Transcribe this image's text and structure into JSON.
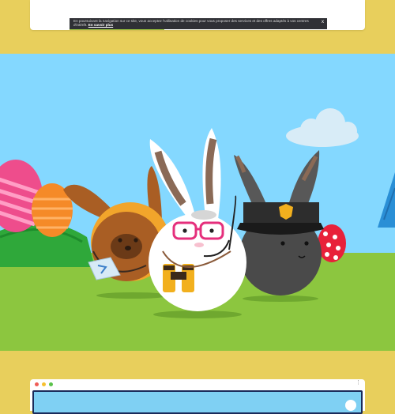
{
  "cookie_banner": {
    "text": "En poursuivant la navigation sur ce site, vous acceptez l'utilisation de cookies pour vous proposer des services et des offres adaptés à vos centres d'intérêt.",
    "link": "En savoir plus",
    "close": "x"
  },
  "browser": {
    "menu": "⋮"
  },
  "colors": {
    "background_band": "#e8cf5c",
    "sky": "#84d8ff",
    "grass": "#8cc63f",
    "hill": "#2fa83a"
  },
  "icons": [
    "close-icon",
    "browser-menu-icon",
    "cloud-icon",
    "egg-icon",
    "tree-icon",
    "binoculars-icon",
    "police-cap-icon",
    "headset-icon",
    "map-icon"
  ]
}
